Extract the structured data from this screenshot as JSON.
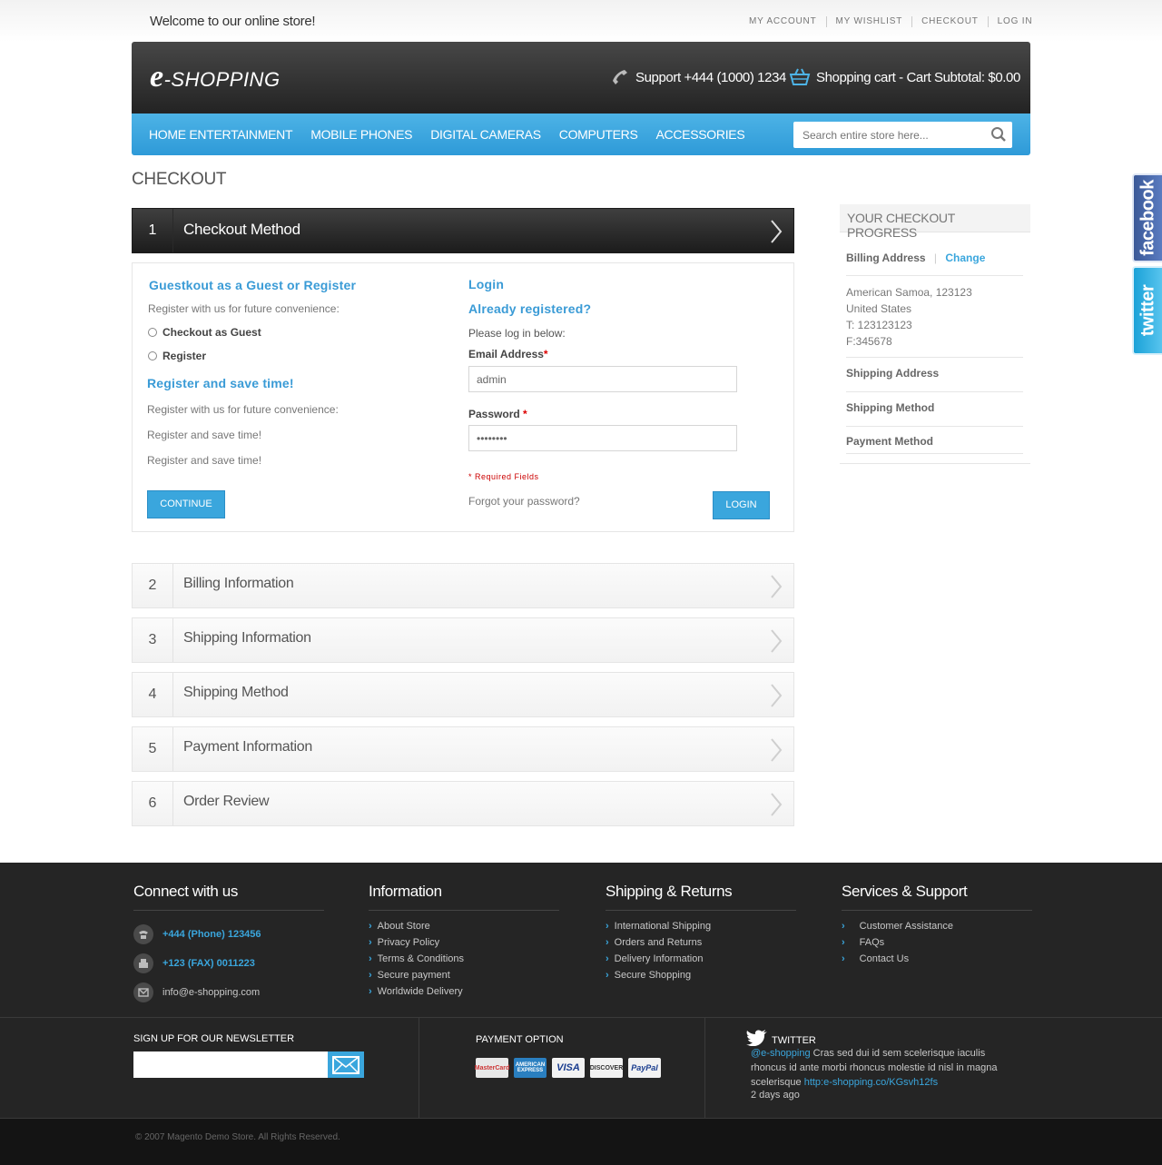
{
  "top": {
    "welcome": "Welcome to our online store!",
    "links": [
      "MY ACCOUNT",
      "MY WISHLIST",
      "CHECKOUT",
      "LOG IN"
    ]
  },
  "header": {
    "logo_e": "e",
    "logo_rest": "-SHOPPING",
    "support": "Support +444 (1000) 1234",
    "cart": "Shopping cart - Cart Subtotal: $0.00"
  },
  "nav": {
    "items": [
      "HOME ENTERTAINMENT",
      "MOBILE PHONES",
      "DIGITAL CAMERAS",
      "COMPUTERS",
      "ACCESSORIES"
    ],
    "search_placeholder": "Search entire store here..."
  },
  "page_title": "CHECKOUT",
  "steps": [
    {
      "num": "1",
      "label": "Checkout Method"
    },
    {
      "num": "2",
      "label": "Billing Information"
    },
    {
      "num": "3",
      "label": "Shipping Information"
    },
    {
      "num": "4",
      "label": "Shipping Method"
    },
    {
      "num": "5",
      "label": "Payment Information"
    },
    {
      "num": "6",
      "label": "Order Review"
    }
  ],
  "method": {
    "guest_title": "Guestkout as a Guest or Register",
    "guest_sub": "Register with us for future convenience:",
    "opt_guest": "Checkout as Guest",
    "opt_register": "Register",
    "save_title": "Register and save time!",
    "save_lines": [
      "Register with us for future convenience:",
      "Register and save time!",
      "Register and save time!"
    ],
    "continue": "CONTINUE",
    "login_title": "Login",
    "already": "Already registered?",
    "please": "Please log in below:",
    "email_label": "Email Address",
    "email_value": "admin",
    "password_label": "Password",
    "password_value": "••••••••",
    "required": "* Required Fields",
    "forgot": "Forgot your password?",
    "login_btn": "LOGIN"
  },
  "progress": {
    "title": "YOUR CHECKOUT PROGRESS",
    "billing": "Billing Address",
    "change": "Change",
    "address": [
      "American Samoa, 123123",
      "United States",
      "T: 123123123",
      "F:345678"
    ],
    "shipping_address": "Shipping Address",
    "shipping_method": "Shipping Method",
    "payment_method": "Payment Method"
  },
  "social": {
    "facebook": "facebook",
    "twitter": "twitter"
  },
  "footer": {
    "connect_title": "Connect with us",
    "phone": "+444 (Phone) 123456",
    "fax": "+123 (FAX) 0011223",
    "email": "info@e-shopping.com",
    "info_title": "Information",
    "info_links": [
      "About Store",
      "Privacy Policy",
      "Terms & Conditions",
      "Secure payment",
      "Worldwide Delivery"
    ],
    "ship_title": "Shipping & Returns",
    "ship_links": [
      "International Shipping",
      "Orders and Returns",
      "Delivery Information",
      "Secure Shopping"
    ],
    "serv_title": "Services & Support",
    "serv_links": [
      "Customer Assistance",
      "FAQs",
      "Contact Us"
    ],
    "newsletter_title": "SIGN UP FOR OUR NEWSLETTER",
    "payment_title": "PAYMENT OPTION",
    "cards": [
      "MasterCard",
      "AMERICAN EXPRESS",
      "VISA",
      "DISCOVER",
      "PayPal"
    ],
    "twitter_title": "TWITTER",
    "tweet_handle": "@e-shopping",
    "tweet_text": " Cras sed dui id sem scelerisque iaculis rhoncus id ante morbi rhoncus molestie id nisl in magna scelerisque ",
    "tweet_link": "http:e-shopping.co/KGsvh12fs",
    "tweet_time": "2 days ago",
    "copyright": "© 2007 Magento Demo Store. All Rights Reserved."
  },
  "colors": {
    "accent": "#3aa6dd",
    "header_dark": "#232323",
    "footer": "#252525"
  }
}
